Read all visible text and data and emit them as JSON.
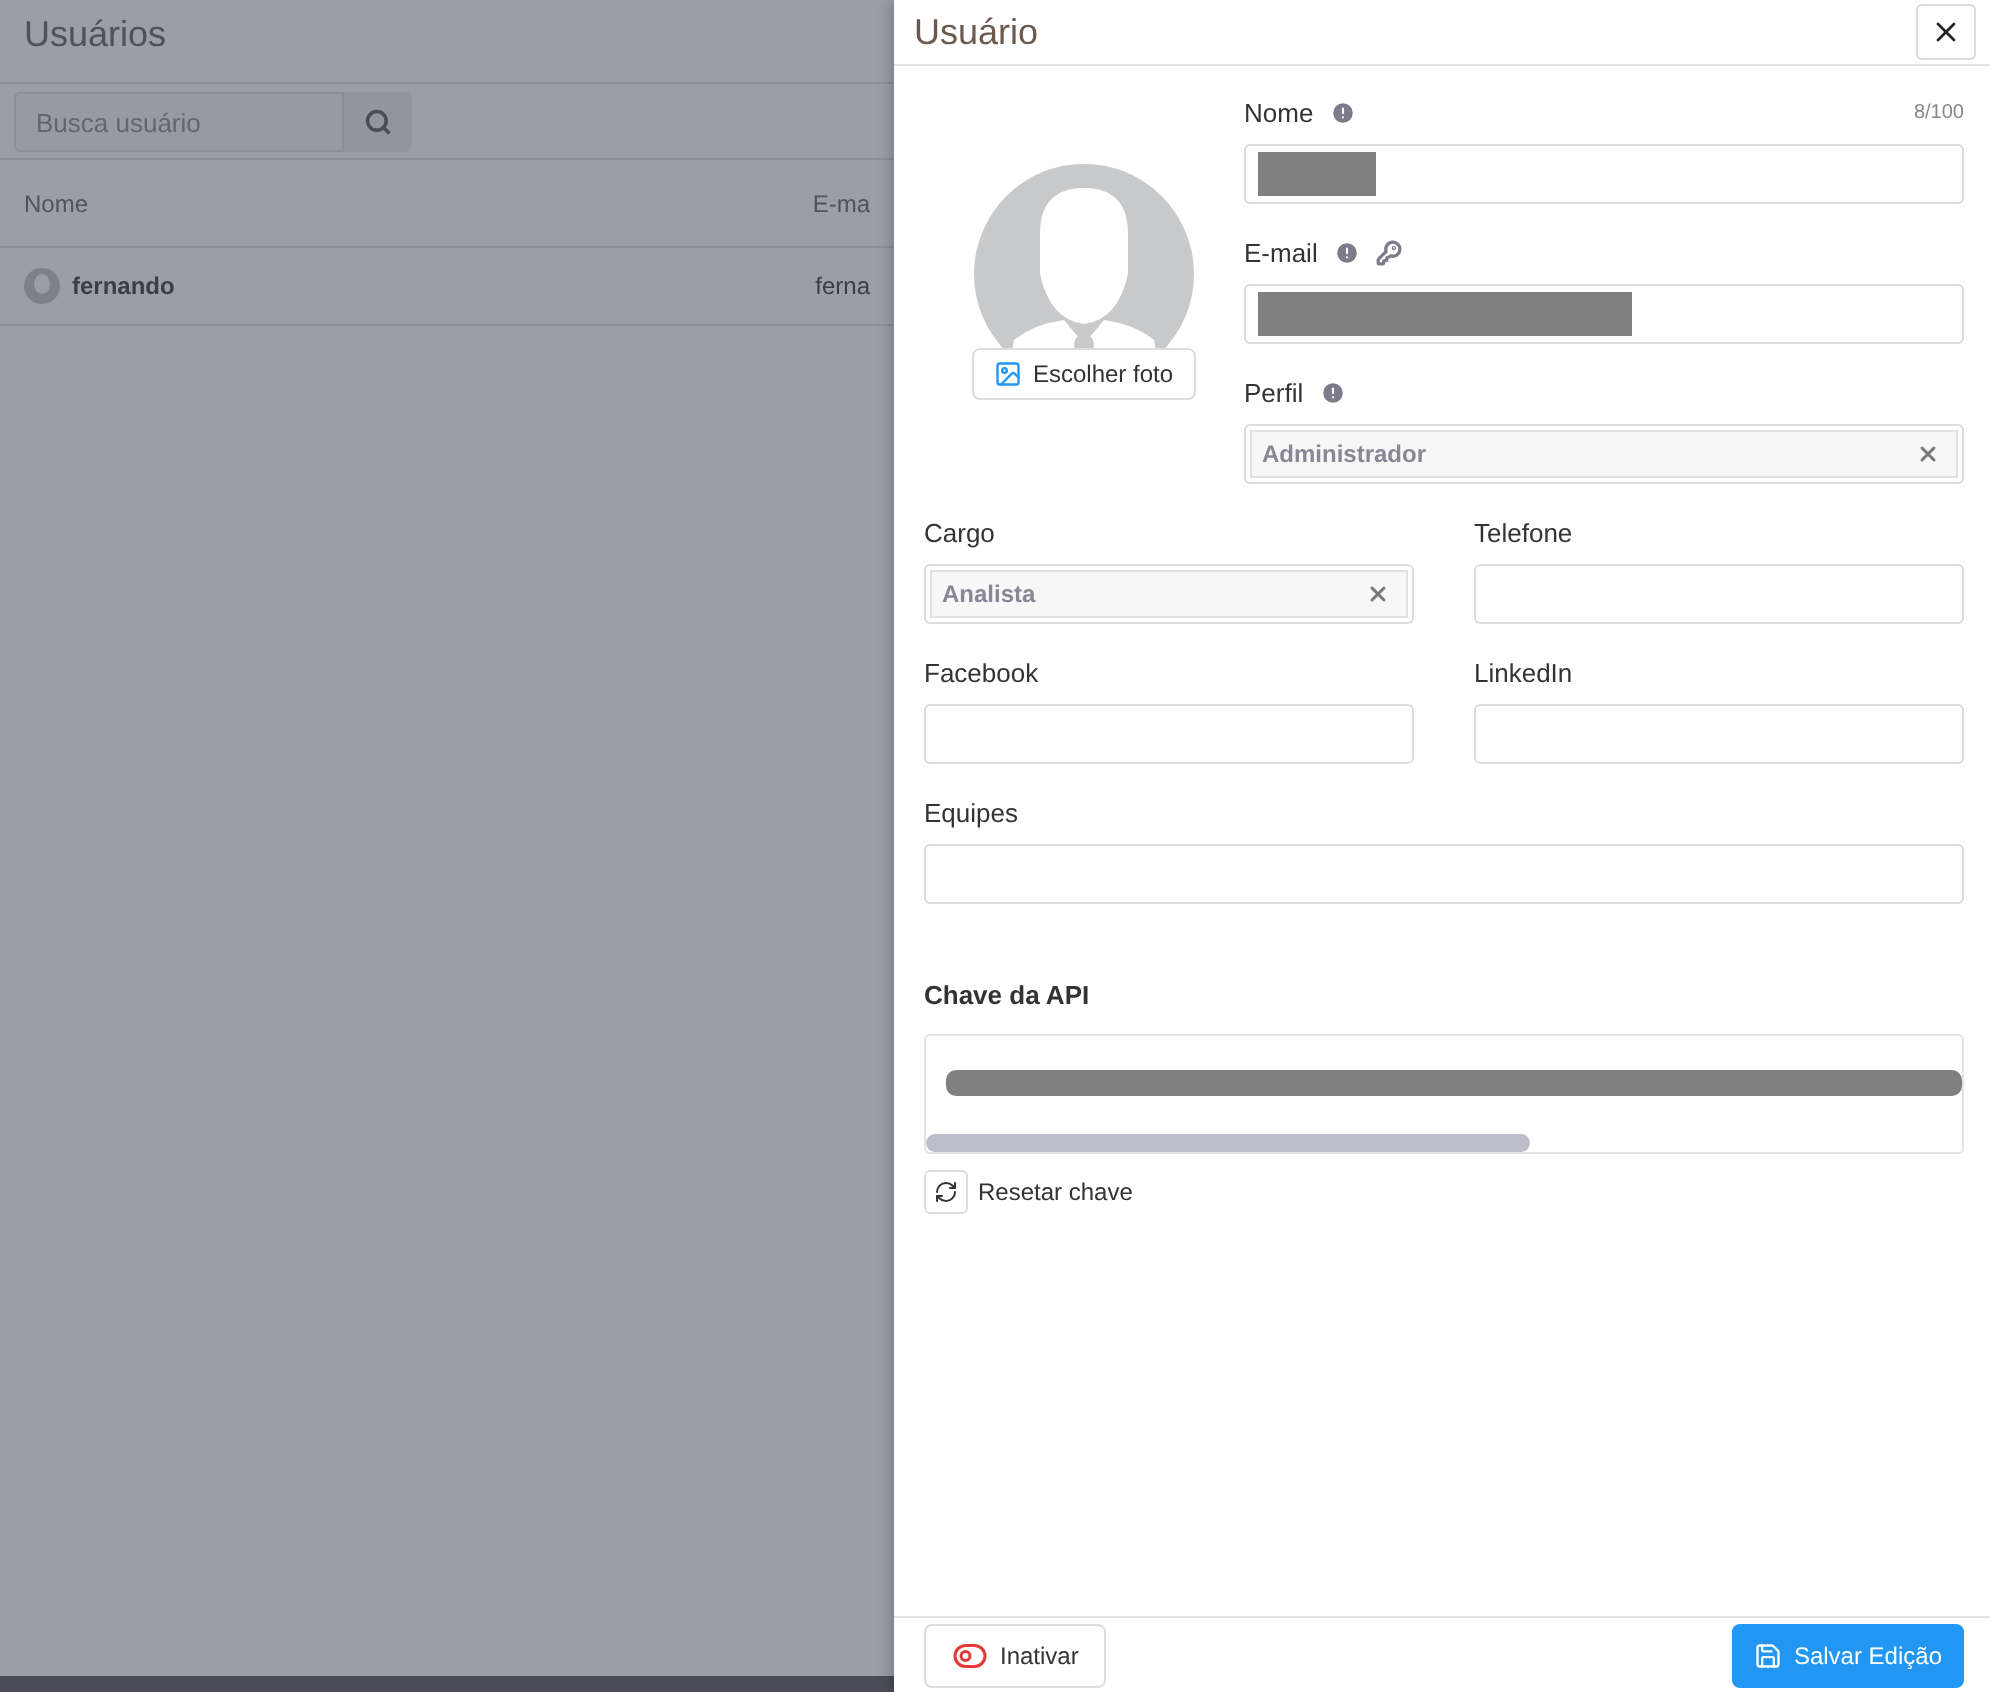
{
  "page": {
    "title": "Usuários",
    "search": {
      "placeholder": "Busca usuário"
    },
    "columns": [
      "Nome",
      "E-ma"
    ],
    "rows": [
      {
        "name": "fernando",
        "email": "ferna"
      }
    ]
  },
  "drawer": {
    "title": "Usuário",
    "photo_button": "Escolher foto",
    "top_fields": [
      {
        "label": "Nome",
        "kind": "text",
        "info": true,
        "counter": "8/100",
        "redacted": true
      },
      {
        "label": "E-mail",
        "kind": "text",
        "info": true,
        "key": true,
        "redacted": true
      },
      {
        "label": "Perfil",
        "kind": "select",
        "info": true,
        "value": "Administrador"
      }
    ],
    "fields": [
      {
        "label": "Cargo",
        "kind": "select",
        "value": "Analista"
      },
      {
        "label": "Telefone",
        "kind": "text"
      },
      {
        "label": "Facebook",
        "kind": "text"
      },
      {
        "label": "LinkedIn",
        "kind": "text"
      },
      {
        "label": "Equipes",
        "kind": "text"
      }
    ],
    "api_key": {
      "label": "Chave da API",
      "redacted": true,
      "reset_button": "Resetar chave"
    },
    "footer": {
      "deactivate_button": "Inativar",
      "save_button": "Salvar Edição"
    }
  }
}
